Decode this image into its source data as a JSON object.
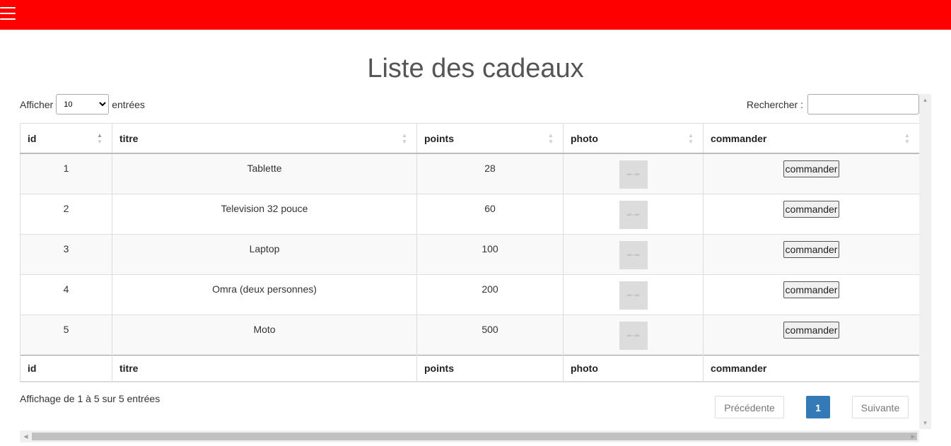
{
  "header": {
    "menu_icon": "hamburger-menu-icon",
    "color": "#ff0000"
  },
  "page": {
    "title": "Liste des cadeaux"
  },
  "length_control": {
    "label_before": "Afficher",
    "selected": "10",
    "options": [
      "10"
    ],
    "label_after": "entrées"
  },
  "search": {
    "label": "Rechercher :",
    "value": ""
  },
  "table": {
    "columns": [
      "id",
      "titre",
      "points",
      "photo",
      "commander"
    ],
    "rows": [
      {
        "id": "1",
        "titre": "Tablette",
        "points": "28",
        "photo": "400 × 400",
        "commander": "commander"
      },
      {
        "id": "2",
        "titre": "Television 32 pouce",
        "points": "60",
        "photo": "400 × 400",
        "commander": "commander"
      },
      {
        "id": "3",
        "titre": "Laptop",
        "points": "100",
        "photo": "400 × 400",
        "commander": "commander"
      },
      {
        "id": "4",
        "titre": "Omra (deux personnes)",
        "points": "200",
        "photo": "400 × 400",
        "commander": "commander"
      },
      {
        "id": "5",
        "titre": "Moto",
        "points": "500",
        "photo": "400 × 400",
        "commander": "commander"
      }
    ],
    "footer_columns": [
      "id",
      "titre",
      "points",
      "photo",
      "commander"
    ]
  },
  "info": "Affichage de 1 à 5 sur 5 entrées",
  "pagination": {
    "previous": "Précédente",
    "current": "1",
    "next": "Suivante",
    "accent": "#337ab7"
  }
}
